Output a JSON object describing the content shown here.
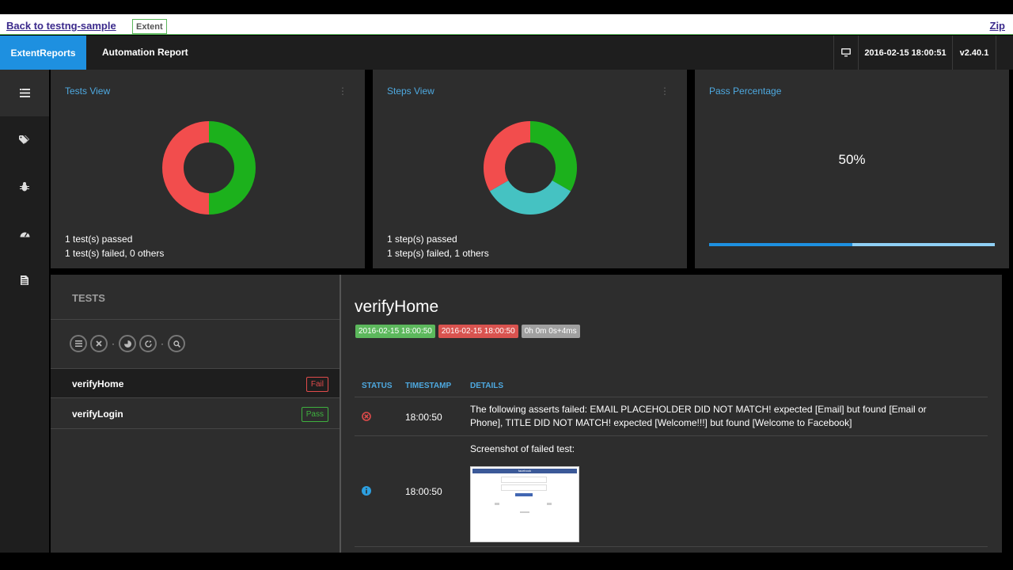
{
  "linkbar": {
    "back_label": "Back to testng-sample",
    "brand_label": "Extent",
    "zip_label": "Zip"
  },
  "nav": {
    "logo_label": "ExtentReports",
    "title": "Automation Report",
    "monitor_icon": "monitor-icon",
    "datetime": "2016-02-15 18:00:51",
    "version": "v2.40.1"
  },
  "sidebar": {
    "items": [
      {
        "icon": "list-icon",
        "active": true
      },
      {
        "icon": "tags-icon",
        "active": false
      },
      {
        "icon": "bug-icon",
        "active": false
      },
      {
        "icon": "dashboard-icon",
        "active": false
      },
      {
        "icon": "document-icon",
        "active": false
      }
    ]
  },
  "cards": {
    "tests": {
      "title": "Tests View",
      "passed_text": "1 test(s) passed",
      "failed_text": "1 test(s) failed, 0 others",
      "donut": [
        {
          "label": "pass",
          "value": 1,
          "color": "#1cb11c"
        },
        {
          "label": "fail",
          "value": 1,
          "color": "#f24d4d"
        }
      ]
    },
    "steps": {
      "title": "Steps View",
      "passed_text": "1 step(s) passed",
      "failed_text": "1 step(s) failed, 1 others",
      "donut": [
        {
          "label": "pass",
          "value": 1,
          "color": "#1cb11c"
        },
        {
          "label": "others",
          "value": 1,
          "color": "#45c2c2"
        },
        {
          "label": "fail",
          "value": 1,
          "color": "#f24d4d"
        }
      ]
    },
    "pass": {
      "title": "Pass Percentage",
      "percent_label": "50%",
      "percent": 50
    }
  },
  "tests_panel": {
    "header": "TESTS",
    "toolbar_icons": [
      "list-icon",
      "close-icon",
      "pie-icon",
      "refresh-icon",
      "search-icon"
    ],
    "tests": [
      {
        "name": "verifyHome",
        "status": "Fail",
        "status_color": "#e04b4b",
        "active": true
      },
      {
        "name": "verifyLogin",
        "status": "Pass",
        "status_color": "#3fb13f",
        "active": false
      }
    ]
  },
  "detail": {
    "name": "verifyHome",
    "badges": [
      {
        "text": "2016-02-15 18:00:50",
        "color": "#5cb85c"
      },
      {
        "text": "2016-02-15 18:00:50",
        "color": "#d9534f"
      },
      {
        "text": "0h 0m 0s+4ms",
        "color": "#a0a0a0"
      }
    ],
    "columns": {
      "status": "STATUS",
      "timestamp": "TIMESTAMP",
      "details": "DETAILS"
    },
    "rows": [
      {
        "status_icon": "fail-circle-icon",
        "status_color": "#e04b4b",
        "timestamp": "18:00:50",
        "details": "The following asserts failed: EMAIL PLACEHOLDER DID NOT MATCH! expected [Email] but found [Email or Phone], TITLE DID NOT MATCH! expected [Welcome!!!] but found [Welcome to Facebook]"
      },
      {
        "status_icon": "info-circle-icon",
        "status_color": "#2d9fe0",
        "timestamp": "18:00:50",
        "details": "Screenshot of failed test:",
        "screenshot_label": "facebook"
      }
    ]
  }
}
